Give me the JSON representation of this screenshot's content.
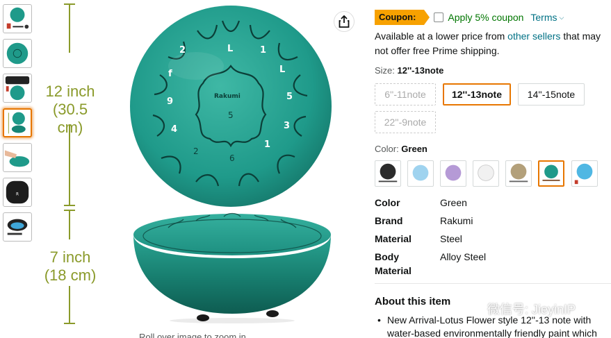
{
  "thumbnails": {
    "items": [
      {
        "name": "thumb-drum-accessories",
        "selected": false
      },
      {
        "name": "thumb-drum-top",
        "selected": false
      },
      {
        "name": "thumb-drum-case",
        "selected": false
      },
      {
        "name": "thumb-drum-dimensions",
        "selected": true
      },
      {
        "name": "thumb-hand-playing",
        "selected": false
      },
      {
        "name": "thumb-carry-bag",
        "selected": false
      },
      {
        "name": "thumb-bag-open",
        "selected": false
      }
    ]
  },
  "main_image": {
    "width_label_line1": "12 inch",
    "width_label_line2": "(30.5 cm)",
    "height_label_line1": "7 inch",
    "height_label_line2": "(18 cm)",
    "brand_on_drum": "Rakumi",
    "drum_notes": [
      "5",
      "6",
      "7",
      "3",
      "4",
      "9",
      "1",
      "2"
    ],
    "drum_color": "#1f9a8a",
    "rollover_text": "Roll over image to zoom in"
  },
  "coupon": {
    "badge": "Coupon:",
    "apply_text": "Apply 5% coupon",
    "terms": "Terms"
  },
  "availability": {
    "text_before": "Available at a lower price from ",
    "link": "other sellers",
    "text_after": " that may not offer free Prime shipping."
  },
  "size": {
    "label": "Size: ",
    "selected": "12''-13note",
    "options": [
      {
        "label": "6''-11note",
        "state": "unavailable"
      },
      {
        "label": "12''-13note",
        "state": "selected"
      },
      {
        "label": "14''-15note",
        "state": "available"
      },
      {
        "label": "22''-9note",
        "state": "unavailable"
      }
    ]
  },
  "color": {
    "label": "Color: ",
    "selected": "Green",
    "swatches": [
      {
        "name": "black",
        "hex": "#2b2b2b"
      },
      {
        "name": "light-blue",
        "hex": "#9fd3ef"
      },
      {
        "name": "purple",
        "hex": "#b59ad6"
      },
      {
        "name": "white",
        "hex": "#f1f1f1"
      },
      {
        "name": "bronze",
        "hex": "#b3a07a"
      },
      {
        "name": "green",
        "hex": "#1f9a8a"
      },
      {
        "name": "sky-blue",
        "hex": "#4fb7e3"
      }
    ]
  },
  "attributes": [
    {
      "key": "Color",
      "value": "Green"
    },
    {
      "key": "Brand",
      "value": "Rakumi"
    },
    {
      "key": "Material",
      "value": "Steel"
    },
    {
      "key": "Body Material",
      "value": "Alloy Steel"
    }
  ],
  "about": {
    "title": "About this item",
    "bullet": "New Arrival-Lotus Flower style 12''-13 note with water-based environmentally friendly paint which"
  },
  "watermark": {
    "text": "微信号: JieyinIP"
  },
  "colors": {
    "accent_orange": "#e77600",
    "coupon_orange": "#f7a100",
    "link_teal": "#007185",
    "green_text": "#007600",
    "dimension_olive": "#8a9a2a"
  }
}
